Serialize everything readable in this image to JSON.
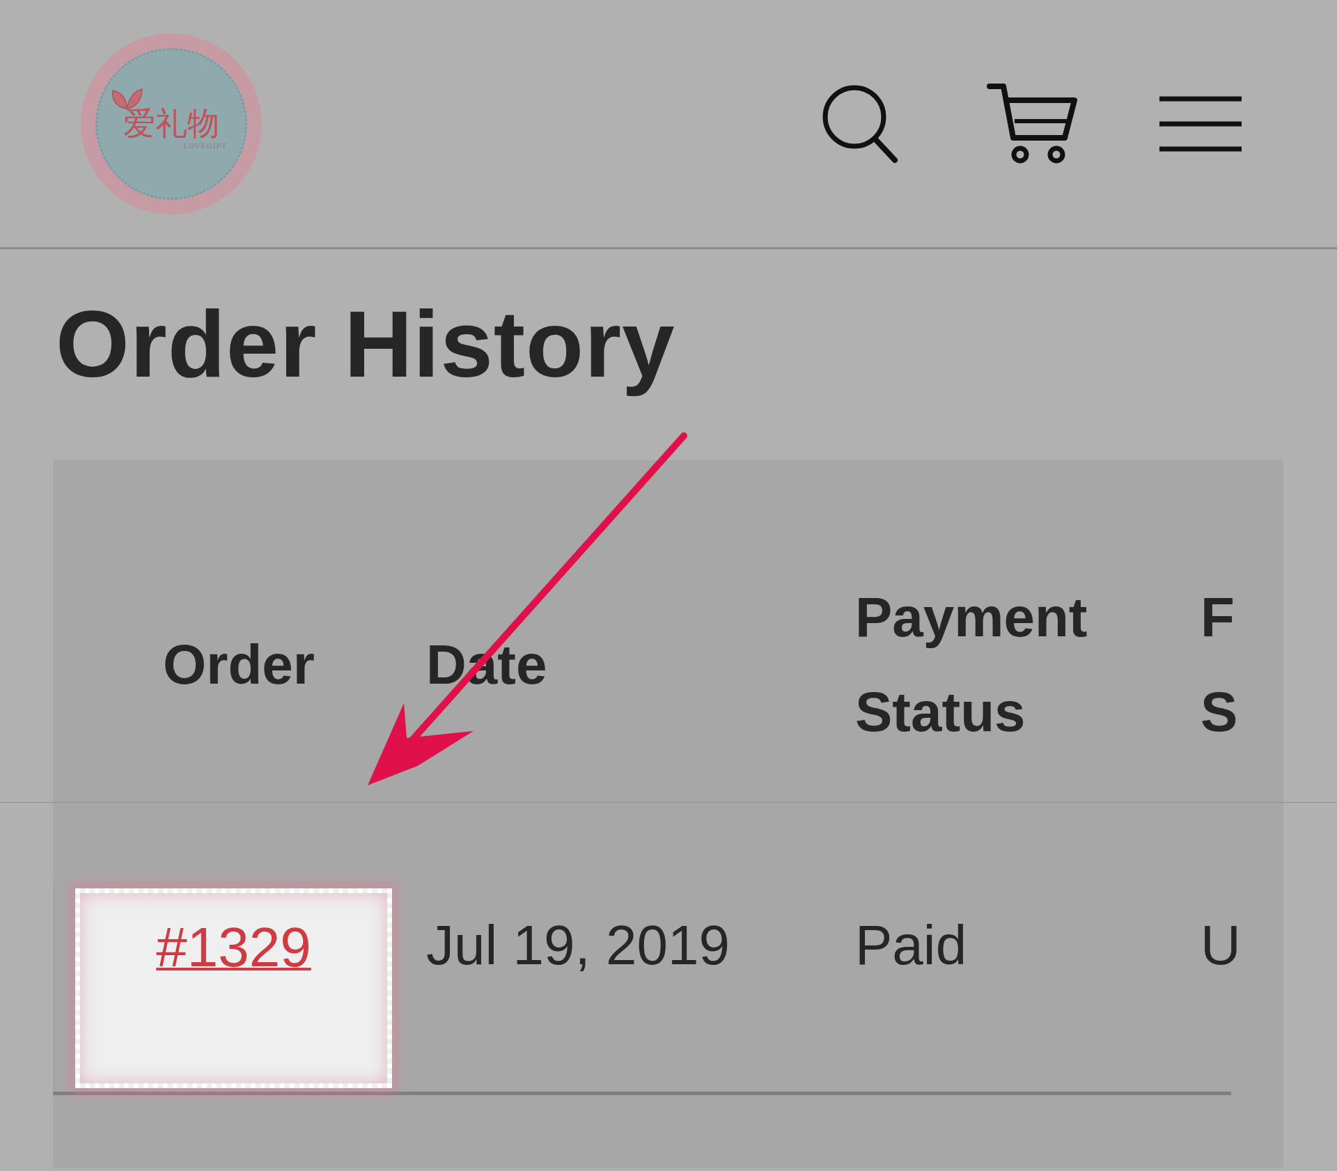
{
  "header": {
    "logo": {
      "name": "爱礼物",
      "tagline": "LOVEGIFT"
    }
  },
  "page_title": "Order History",
  "table": {
    "columns": [
      {
        "lines": [
          "Order"
        ]
      },
      {
        "lines": [
          "Date"
        ]
      },
      {
        "lines": [
          "Payment",
          "Status"
        ]
      },
      {
        "lines": [
          "F",
          "S"
        ]
      }
    ],
    "rows": [
      {
        "order": "#1329",
        "date": "Jul 19, 2019",
        "payment_status": "Paid",
        "column_4": "U"
      }
    ]
  }
}
